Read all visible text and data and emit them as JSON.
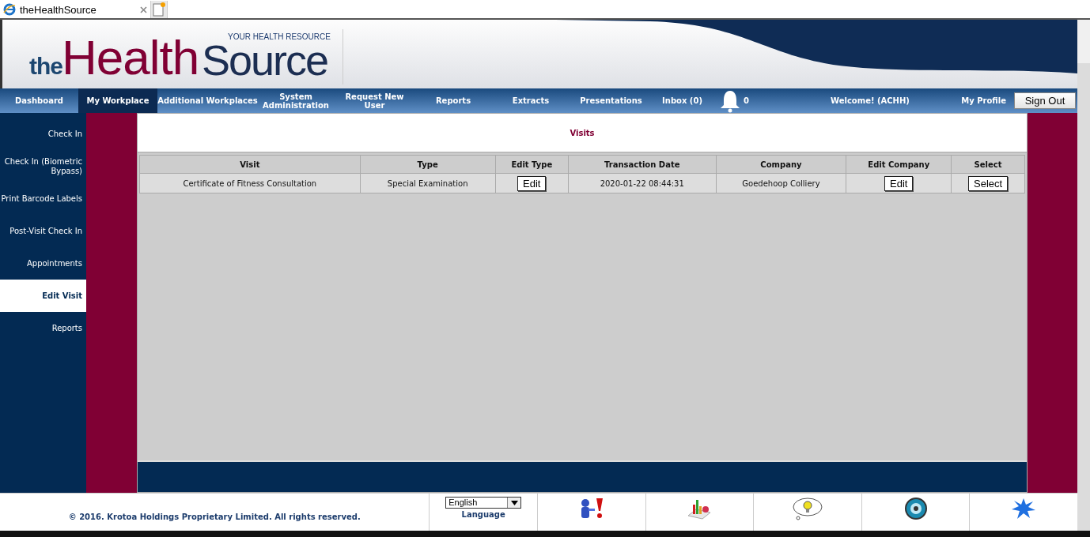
{
  "browser_tab": {
    "title": "theHealthSource"
  },
  "logo": {
    "prefix": "the",
    "main": "Health",
    "suffix": "Source",
    "tagline": "YOUR HEALTH RESOURCE"
  },
  "nav": [
    {
      "label": "Dashboard",
      "selected": false
    },
    {
      "label": "My Workplace",
      "selected": true
    },
    {
      "label": "Additional Workplaces",
      "selected": false
    },
    {
      "label": "System Administration",
      "selected": false
    },
    {
      "label": "Request New User",
      "selected": false
    },
    {
      "label": "Reports",
      "selected": false
    },
    {
      "label": "Extracts",
      "selected": false
    },
    {
      "label": "Presentations",
      "selected": false
    },
    {
      "label": "Inbox (0)",
      "selected": false
    }
  ],
  "notifications": {
    "count": "0"
  },
  "welcome": "Welcome! (ACHH)",
  "my_profile": "My Profile",
  "sign_out": "Sign Out",
  "sidebar": {
    "items": [
      {
        "label": "Check In",
        "selected": false
      },
      {
        "label": "Check In (Biometric Bypass)",
        "selected": false
      },
      {
        "label": "Print Barcode Labels",
        "selected": false
      },
      {
        "label": "Post-Visit Check In",
        "selected": false
      },
      {
        "label": "Appointments",
        "selected": false
      },
      {
        "label": "Edit Visit",
        "selected": true
      },
      {
        "label": "Reports",
        "selected": false
      }
    ]
  },
  "panel_title": "Visits",
  "table": {
    "columns": [
      "Visit",
      "Type",
      "Edit Type",
      "Transaction Date",
      "Company",
      "Edit Company",
      "Select"
    ],
    "rows": [
      {
        "cells": [
          {
            "kind": "text",
            "text": "Certificate of Fitness Consultation"
          },
          {
            "kind": "text",
            "text": "Special Examination"
          },
          {
            "kind": "button",
            "text": "Edit"
          },
          {
            "kind": "text",
            "text": "2020-01-22 08:44:31"
          },
          {
            "kind": "text",
            "text": "Goedehoop Colliery"
          },
          {
            "kind": "button",
            "text": "Edit"
          },
          {
            "kind": "button",
            "text": "Select"
          }
        ]
      }
    ]
  },
  "footer": {
    "copyright": "© 2016. Krotoa Holdings Proprietary Limited. All rights reserved.",
    "language": {
      "value": "English",
      "label": "Language"
    },
    "links": [
      {
        "kind": "incident"
      },
      {
        "kind": "stats"
      },
      {
        "kind": "idea"
      },
      {
        "kind": "help"
      },
      {
        "kind": "news"
      }
    ]
  }
}
